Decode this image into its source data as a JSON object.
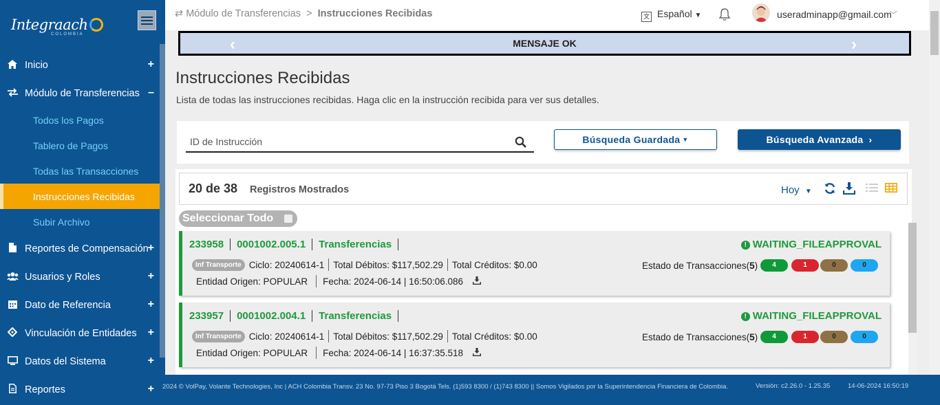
{
  "app": {
    "logo_text": "Integraach",
    "logo_sub": "COLOMBIA"
  },
  "sidebar": {
    "items": [
      {
        "label": "Inicio",
        "icon": "home-icon",
        "toggle": "+"
      },
      {
        "label": "Módulo de Transferencias",
        "icon": "exchange-icon",
        "toggle": "–"
      },
      {
        "label": "Reportes de Compensación",
        "icon": "file-icon",
        "toggle": "+"
      },
      {
        "label": "Usuarios y Roles",
        "icon": "users-icon",
        "toggle": "+"
      },
      {
        "label": "Dato de Referencia",
        "icon": "calendar-icon",
        "toggle": "+"
      },
      {
        "label": "Vinculación de Entidades",
        "icon": "link-icon",
        "toggle": "+"
      },
      {
        "label": "Datos del Sistema",
        "icon": "monitor-icon",
        "toggle": "+"
      },
      {
        "label": "Reportes",
        "icon": "report-icon",
        "toggle": "+"
      }
    ],
    "subitems": [
      {
        "label": "Todos los Pagos"
      },
      {
        "label": "Tablero de Pagos"
      },
      {
        "label": "Todas las Transacciones"
      },
      {
        "label": "Instrucciones Recibidas",
        "active": true
      },
      {
        "label": "Subir Archivo"
      }
    ]
  },
  "topbar": {
    "breadcrumb_parent": "Módulo de Transferencias",
    "breadcrumb_sep": ">",
    "breadcrumb_current": "Instrucciones Recibidas",
    "language": "Español",
    "user_email": "useradminapp@gmail.com"
  },
  "banner": {
    "message": "MENSAJE OK"
  },
  "page": {
    "title": "Instrucciones Recibidas",
    "description": "Lista de todas las instrucciones recibidas. Haga clic en la instrucción recibida para ver sus detalles."
  },
  "search": {
    "placeholder": "ID de Instrucción",
    "saved_label": "Búsqueda Guardada",
    "advanced_label": "Búsqueda Avanzada"
  },
  "results": {
    "count_text": "20 de 38",
    "count_label": "Registros Mostrados",
    "period": "Hoy",
    "select_all": "Seleccionar Todo",
    "tx_label": "Estado de Transacciones(",
    "tx_label_bold": "5",
    "tx_label_end": ") :",
    "items": [
      {
        "id": "233958",
        "ref": "0001002.005.1",
        "type": "Transferencias",
        "status": "WAITING_FILEAPPROVAL",
        "tag": "Inf Transporte",
        "cycle": "Ciclo: 20240614-1",
        "debits": "Total Débitos: $117,502.29",
        "credits": "Total Créditos: $0.00",
        "origin": "Entidad Origen: POPULAR",
        "date": "Fecha: 2024-06-14 | 16:50:06.086",
        "badges": [
          "4",
          "1",
          "0",
          "0"
        ]
      },
      {
        "id": "233957",
        "ref": "0001002.004.1",
        "type": "Transferencias",
        "status": "WAITING_FILEAPPROVAL",
        "tag": "Inf Transporte",
        "cycle": "Ciclo: 20240614-1",
        "debits": "Total Débitos: $117,502.29",
        "credits": "Total Créditos: $0.00",
        "origin": "Entidad Origen: POPULAR",
        "date": "Fecha: 2024-06-14 | 16:37:35.518",
        "badges": [
          "4",
          "1",
          "0",
          "0"
        ]
      }
    ]
  },
  "footer": {
    "copyright": "2024 © VolPay, Volante Technologies, Inc | ACH Colombia Transv. 23 No. 97-73 Piso 3 Bogotá Tels. (1)593 8300 / (1)743 8300 || Somos Vigilados por la Superintendencia Financiera de Colombia.",
    "version": "Versión: c2.26.0 - 1.25.35",
    "timestamp": "14-06-2024 16:50:19"
  },
  "colors": {
    "sidebar": "#0d5493",
    "active": "#f5a500",
    "success": "#1e9a3c",
    "badge_green": "#0f9a3a",
    "badge_red": "#d9262e",
    "badge_brown": "#8e7144",
    "badge_blue": "#1fa6f0"
  }
}
